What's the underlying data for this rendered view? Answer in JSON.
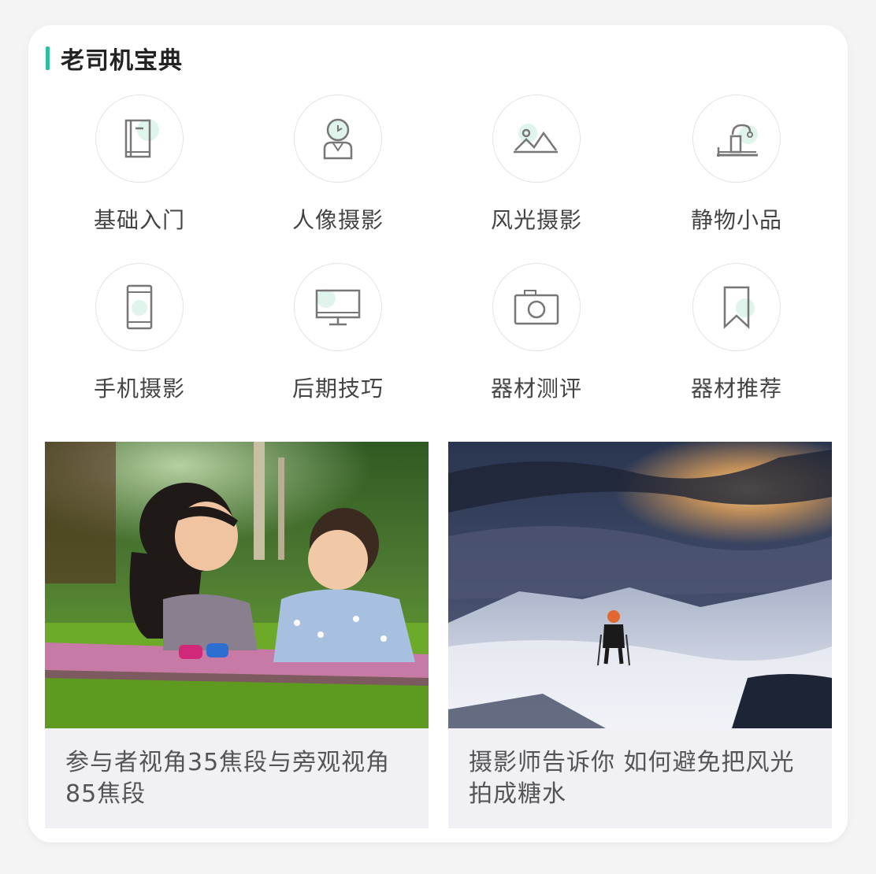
{
  "section": {
    "title": "老司机宝典",
    "accent_color": "#2bbf9a"
  },
  "categories": [
    {
      "label": "基础入门",
      "icon": "book-icon"
    },
    {
      "label": "人像摄影",
      "icon": "portrait-icon"
    },
    {
      "label": "风光摄影",
      "icon": "landscape-icon"
    },
    {
      "label": "静物小品",
      "icon": "lamp-icon"
    },
    {
      "label": "手机摄影",
      "icon": "phone-icon"
    },
    {
      "label": "后期技巧",
      "icon": "monitor-icon"
    },
    {
      "label": "器材测评",
      "icon": "camera-icon"
    },
    {
      "label": "器材推荐",
      "icon": "bookmark-icon"
    }
  ],
  "articles": [
    {
      "caption": "参与者视角35焦段与旁观视角85焦段",
      "image": "children-on-grass-photo"
    },
    {
      "caption": "摄影师告诉你 如何避免把风光拍成糖水",
      "image": "mountain-hiker-photo"
    }
  ]
}
